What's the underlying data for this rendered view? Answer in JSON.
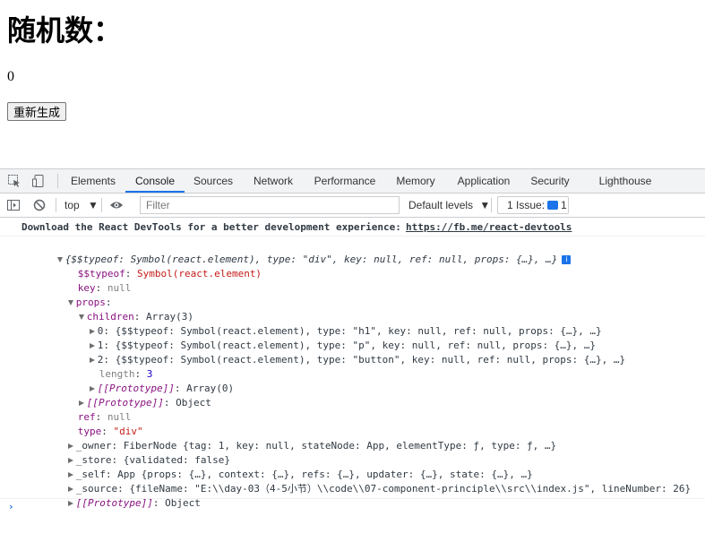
{
  "page": {
    "heading": "随机数：",
    "number": "0",
    "button_label": "重新生成"
  },
  "devtools": {
    "tabs": [
      "Elements",
      "Console",
      "Sources",
      "Network",
      "Performance",
      "Memory",
      "Application",
      "Security",
      "Lighthouse"
    ],
    "active_tab": "Console",
    "toolbar": {
      "context": "top",
      "filter_placeholder": "Filter",
      "levels": "Default levels",
      "issues_label": "1 Issue:",
      "issues_count": "1"
    },
    "console": {
      "message_text": "Download the React DevTools for a better development experience: ",
      "message_link": "https://fb.me/react-devtools",
      "obj_summary": "{$$typeof: Symbol(react.element), type: \"div\", key: null, ref: null, props: {…}, …}",
      "l_typeof_key": "$$typeof",
      "l_typeof_val": "Symbol(react.element)",
      "l_key_key": "key",
      "l_key_val": "null",
      "l_props_key": "props",
      "l_children_key": "children",
      "l_children_val": "Array(3)",
      "child0": "0: {$$typeof: Symbol(react.element), type: \"h1\", key: null, ref: null, props: {…}, …}",
      "child1": "1: {$$typeof: Symbol(react.element), type: \"p\", key: null, ref: null, props: {…}, …}",
      "child2": "2: {$$typeof: Symbol(react.element), type: \"button\", key: null, ref: null, props: {…}, …}",
      "l_length_key": "length",
      "l_length_val": "3",
      "l_proto_arr_key": "[[Prototype]]",
      "l_proto_arr_val": "Array(0)",
      "l_proto_obj_key": "[[Prototype]]",
      "l_proto_obj_val": "Object",
      "l_ref_key": "ref",
      "l_ref_val": "null",
      "l_type_key": "type",
      "l_type_val": "\"div\"",
      "l_owner": "_owner: FiberNode {tag: 1, key: null, stateNode: App, elementType: ƒ, type: ƒ, …}",
      "l_store": "_store: {validated: false}",
      "l_self": "_self: App {props: {…}, context: {…}, refs: {…}, updater: {…}, state: {…}, …}",
      "l_source": "_source: {fileName: \"E:\\\\day-03（4-5小节）\\\\code\\\\07-component-principle\\\\src\\\\index.js\", lineNumber: 26}",
      "l_proto_last_key": "[[Prototype]]",
      "l_proto_last_val": "Object",
      "prompt": "›"
    }
  },
  "colors": {
    "accent": "#1a73e8",
    "key": "#881280",
    "string": "#c41a16",
    "number": "#1c00cf"
  }
}
